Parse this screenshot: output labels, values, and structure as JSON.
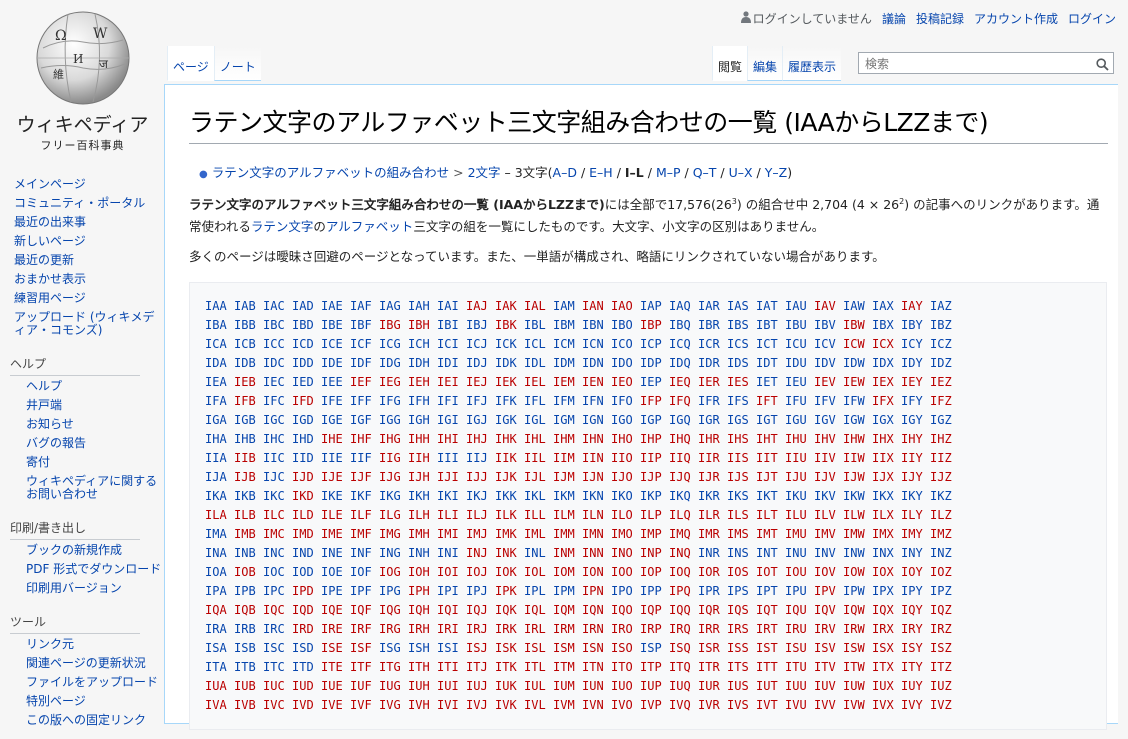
{
  "logo": {
    "wordmark": "ウィキペディア",
    "tagline": "フリー百科事典"
  },
  "personal": {
    "not_logged_in": "ログインしていません",
    "talk": "議論",
    "contributions": "投稿記録",
    "create_account": "アカウント作成",
    "login": "ログイン"
  },
  "tabs_left": [
    "ページ",
    "ノート"
  ],
  "tabs_right": [
    "閲覧",
    "編集",
    "履歴表示"
  ],
  "search": {
    "placeholder": "検索"
  },
  "sidebar": {
    "main": [
      "メインページ",
      "コミュニティ・ポータル",
      "最近の出来事",
      "新しいページ",
      "最近の更新",
      "おまかせ表示",
      "練習用ページ",
      "アップロード (ウィキメディア・コモンズ)"
    ],
    "help_heading": "ヘルプ",
    "help": [
      "ヘルプ",
      "井戸端",
      "お知らせ",
      "バグの報告",
      "寄付",
      "ウィキペディアに関するお問い合わせ"
    ],
    "print_heading": "印刷/書き出し",
    "print": [
      "ブックの新規作成",
      "PDF 形式でダウンロード",
      "印刷用バージョン"
    ],
    "tools_heading": "ツール",
    "tools": [
      "リンク元",
      "関連ページの更新状況",
      "ファイルをアップロード",
      "特別ページ",
      "この版への固定リンク"
    ]
  },
  "article": {
    "title": "ラテン文字のアルファベット三文字組み合わせの一覧 (IAAからLZZまで)",
    "nav": {
      "parent": "ラテン文字のアルファベットの組み合わせ",
      "two": "2文字",
      "sep": " – 3文字(",
      "ranges": [
        "A–D",
        "E–H",
        "I–L",
        "M–P",
        "Q–T",
        "U–X",
        "Y–Z"
      ],
      "close": ")"
    },
    "intro": {
      "bold": "ラテン文字のアルファベット三文字組み合わせの一覧 (IAAからLZZまで)",
      "t1": "には全部で17,576(26",
      "sup1": "3",
      "t2": ") の組合せ中 2,704 (4 × 26",
      "sup2": "2",
      "t3": ") の記事へのリンクがあります。通常使われる",
      "link1": "ラテン文字",
      "t4": "の",
      "link2": "アルファベット",
      "t5": "三文字の組を一覧にしたものです。大文字、小文字の区別はありません。"
    },
    "para2": "多くのページは曖昧さ回避のページとなっています。また、一単語が構成され、略語にリンクされていない場合があります。"
  },
  "combos": {
    "first_letters": [
      "I",
      "L"
    ],
    "rows": [
      {
        "prefix": "IA",
        "red": "JKLNOVY"
      },
      {
        "prefix": "IB",
        "red": "GHKPW"
      },
      {
        "prefix": "IC",
        "red": "WX"
      },
      {
        "prefix": "ID",
        "red": ""
      },
      {
        "prefix": "IE",
        "red": "BFGHIJKLMNOQRSVWXYZ"
      },
      {
        "prefix": "IF",
        "red": "BDPQTXZ"
      },
      {
        "prefix": "IG",
        "red": ""
      },
      {
        "prefix": "IH",
        "red": "EFGHIJKLMNOPQRSTUVWXYZ"
      },
      {
        "prefix": "II",
        "red": "BGHKLMNOPQRSTUVWXYZ"
      },
      {
        "prefix": "IJ",
        "red": "BDEFGHIJKLMNOPQRSTUVWXYZ"
      },
      {
        "prefix": "IK",
        "red": "D"
      },
      {
        "prefix": "IL",
        "red": "ABCDEFGHIJKLMNOPQRSTUVWXYZ"
      },
      {
        "prefix": "IM",
        "red": "BCDEFGHIJKLMNOPQRSTUVWXYZ"
      },
      {
        "prefix": "IN",
        "red": "JKMNOPQ"
      },
      {
        "prefix": "IO",
        "red": "BGHIJKLMNOPQRSTUVWXYZ"
      },
      {
        "prefix": "IP",
        "red": "DHKNQV"
      },
      {
        "prefix": "IQ",
        "red": "ABCDEFGHIJKLMNOPQRSTUVWXYZ"
      },
      {
        "prefix": "IR",
        "red": "DEFGHIJKLMNOPQRSTUVWXYZ"
      },
      {
        "prefix": "IS",
        "red": "EFJKLMNOQRSTUVWXYZ"
      },
      {
        "prefix": "IT",
        "red": "EFGHIJKLMNOPQRSTUVWXYZ"
      },
      {
        "prefix": "IU",
        "red": "ABCDEFGHIJKLMNOPQRSTUVWXYZ"
      },
      {
        "prefix": "IV",
        "red": "ABCDEFGHIJKLMNOPQRSTUVWXYZ"
      }
    ]
  }
}
